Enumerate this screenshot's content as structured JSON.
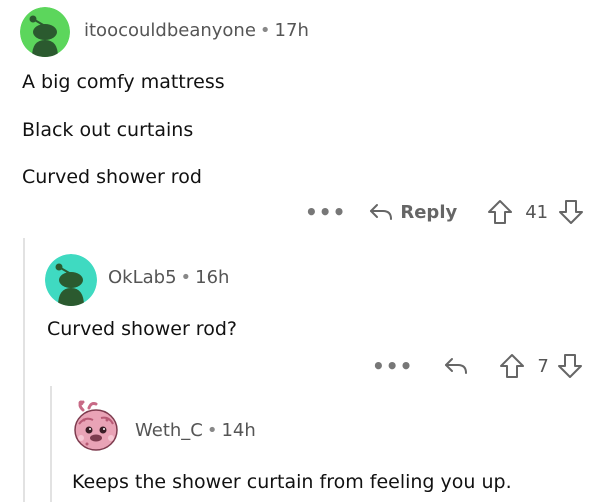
{
  "comments": [
    {
      "author": "itoocouldbeanyone",
      "time": "17h",
      "lines": [
        "A big comfy mattress",
        "Black out curtains",
        "Curved shower rod"
      ],
      "more": "•••",
      "reply_label": "Reply",
      "votes": "41"
    },
    {
      "author": "OkLab5",
      "time": "16h",
      "lines": [
        "Curved shower rod?"
      ],
      "more": "•••",
      "votes": "7"
    },
    {
      "author": "Weth_C",
      "time": "14h",
      "lines": [
        "Keeps the shower curtain from feeling you up."
      ]
    }
  ],
  "separator": "•",
  "colors": {
    "snoo_green": "#5cd65c",
    "snoo_teal": "#3fdac1",
    "snoo_dark": "#2b5a2f",
    "action_gray": "#666666"
  }
}
